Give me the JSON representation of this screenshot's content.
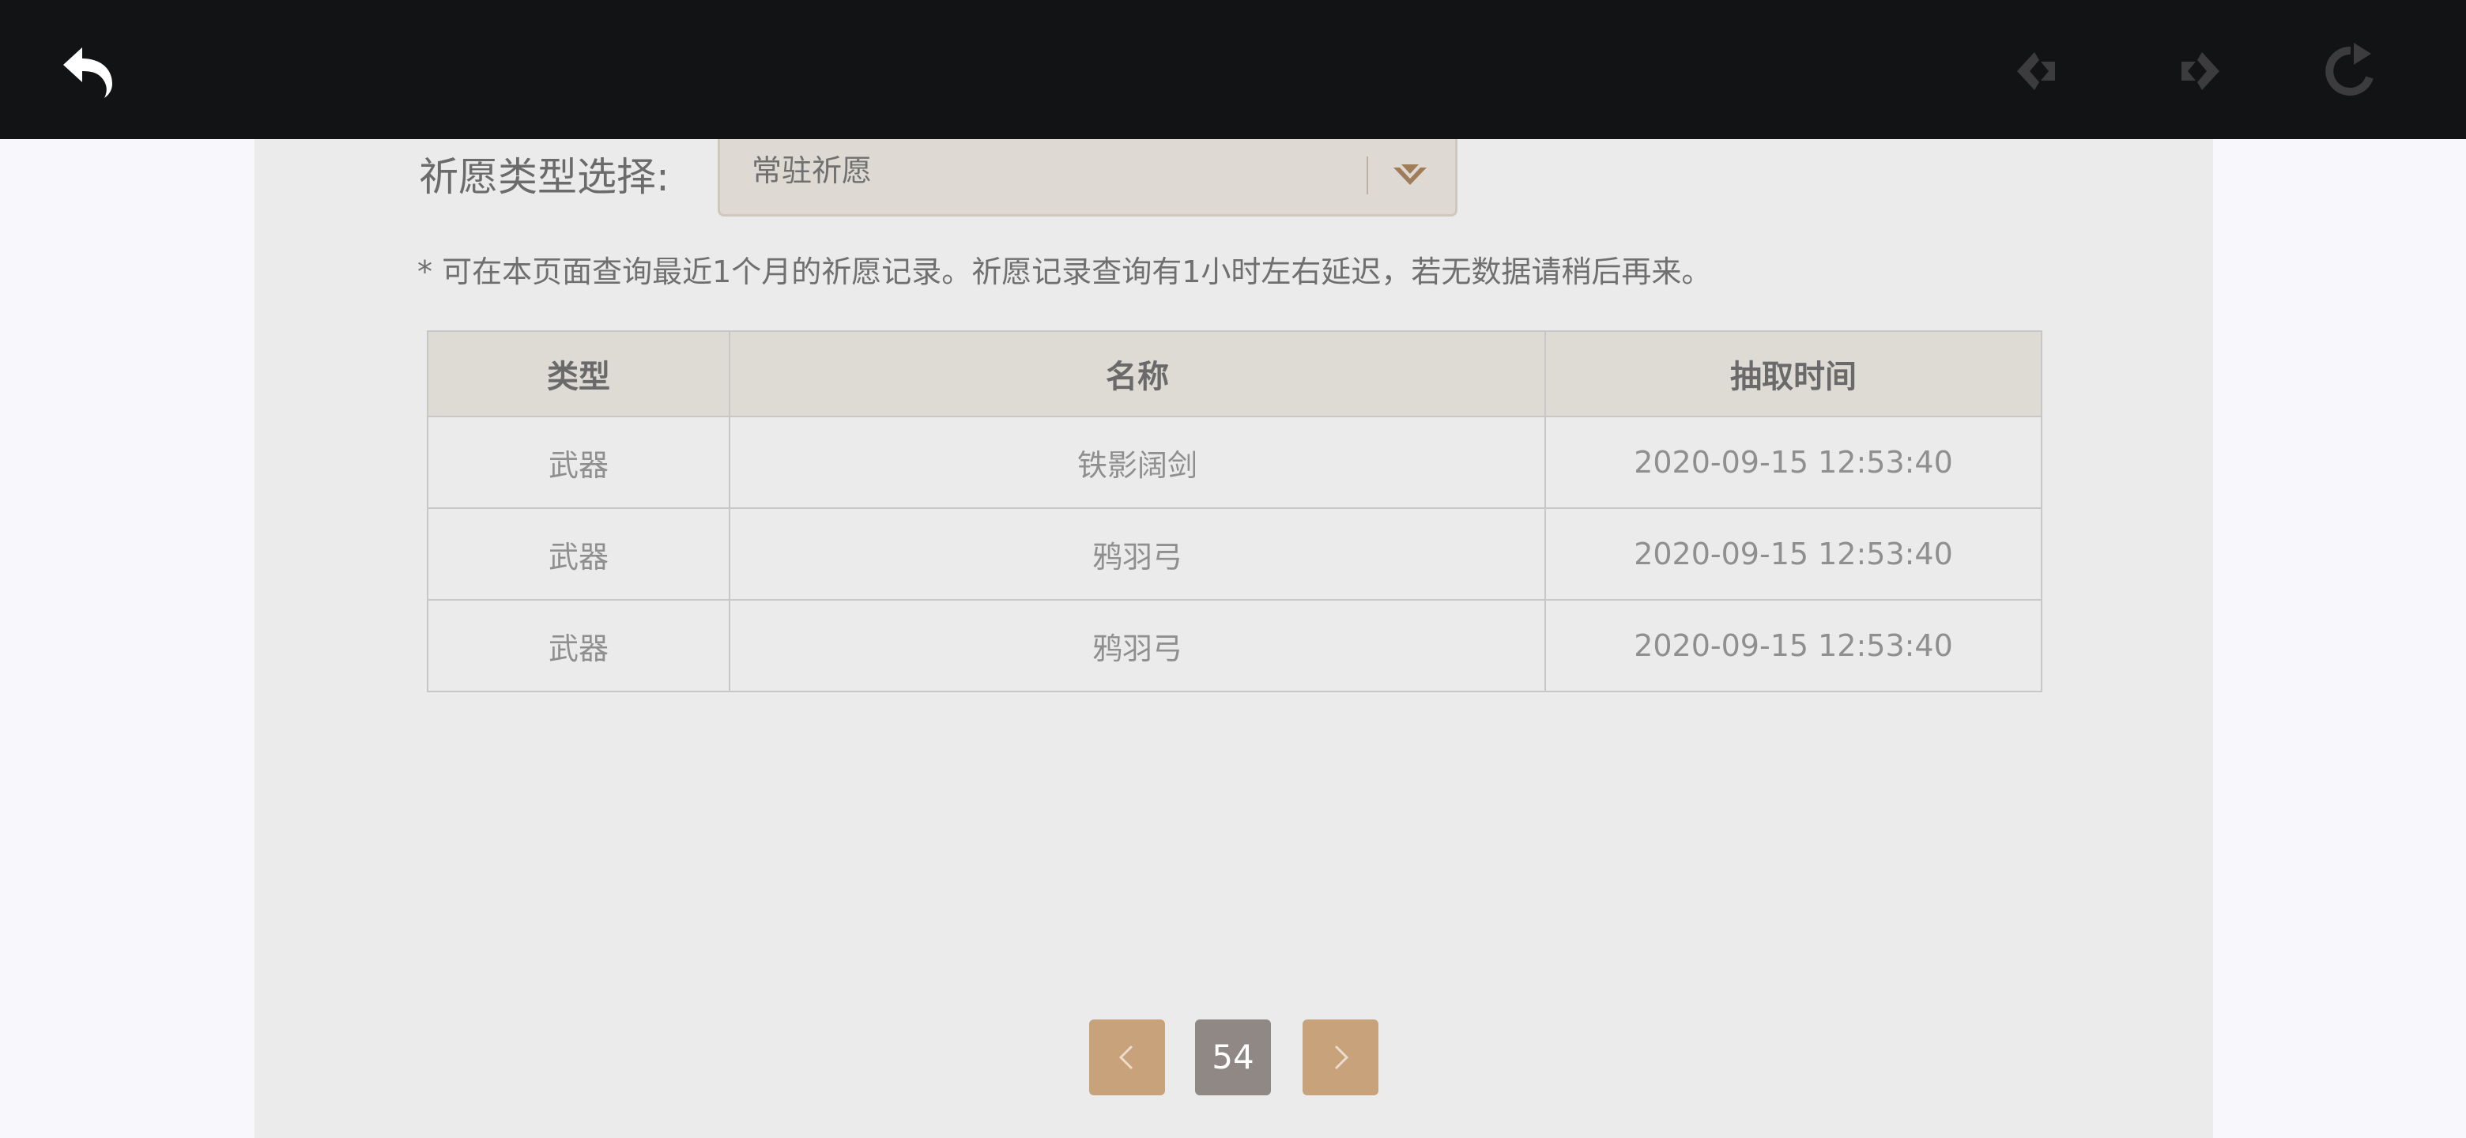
{
  "topbar": {
    "back_icon": "back-arrow-icon",
    "nav_back_icon": "diamond-left-arrow-icon",
    "nav_forward_icon": "diamond-right-arrow-icon",
    "refresh_icon": "refresh-icon"
  },
  "filter": {
    "label": "祈愿类型选择:",
    "selected": "常驻祈愿",
    "arrow_icon": "chevron-down-icon"
  },
  "notice": "* 可在本页面查询最近1个月的祈愿记录。祈愿记录查询有1小时左右延迟，若无数据请稍后再来。",
  "table": {
    "headers": [
      "类型",
      "名称",
      "抽取时间"
    ],
    "rows": [
      {
        "type": "武器",
        "name": "铁影阔剑",
        "time": "2020-09-15 12:53:40"
      },
      {
        "type": "武器",
        "name": "鸦羽弓",
        "time": "2020-09-15 12:53:40"
      },
      {
        "type": "武器",
        "name": "鸦羽弓",
        "time": "2020-09-15 12:53:40"
      }
    ]
  },
  "pagination": {
    "current_page": "54",
    "prev_icon": "chevron-left-icon",
    "next_icon": "chevron-right-icon"
  },
  "colors": {
    "topbar_bg": "#121315",
    "page_bg": "#ebebeb",
    "header_bg": "#dedbd5",
    "pager_accent": "#c7a27b",
    "pager_current": "#908884"
  }
}
